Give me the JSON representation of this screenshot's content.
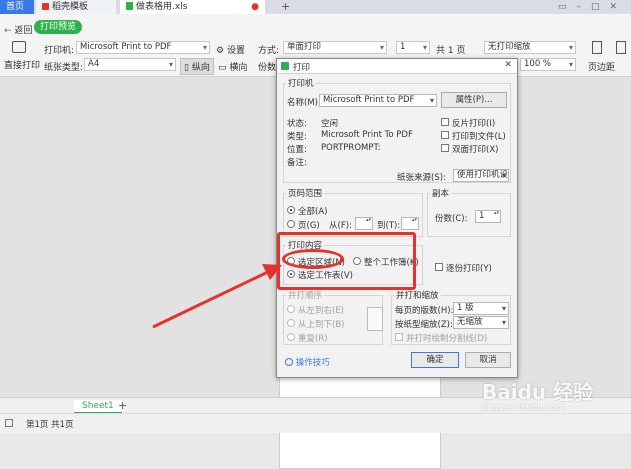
{
  "tabs": {
    "home": "首页",
    "daoke": "稻壳模板",
    "file": "做表格用.xls"
  },
  "toolbar": {
    "back": "返回",
    "preview": "打印预览",
    "printer_label": "打印机:",
    "printer_value": "Microsoft Print to PDF",
    "settings": "设置",
    "mode_label": "方式:",
    "mode_value": "单面打印",
    "copies_value": "1",
    "pages_total": "共 1 页",
    "scale_value": "无打印缩放",
    "direct_print": "直接打印",
    "paper_label": "纸张类型:",
    "paper_value": "A4",
    "portrait": "纵向",
    "landscape": "横向",
    "copies_label": "份数:",
    "zoom_value": "100 %",
    "margin": "页边距"
  },
  "dialog": {
    "title": "打印",
    "printer_group": "打印机",
    "name_label": "名称(M):",
    "name_value": "Microsoft Print to PDF",
    "properties_btn": "属性(P)...",
    "status_label": "状态:",
    "status_value": "空闲",
    "type_label": "类型:",
    "type_value": "Microsoft Print To PDF",
    "location_label": "位置:",
    "location_value": "PORTPROMPT:",
    "comment_label": "备注:",
    "reverse_print": "反片打印(I)",
    "print_to_file": "打印到文件(L)",
    "duplex": "双面打印(X)",
    "paper_source_label": "纸张来源(S):",
    "paper_source_value": "使用打印机设置",
    "range_group": "页码范围",
    "range_all": "全部(A)",
    "range_pages": "页(G)",
    "from_label": "从(F):",
    "to_label": "到(T):",
    "copies_group": "副本",
    "copies_label": "份数(C):",
    "copies_value": "1",
    "content_group": "打印内容",
    "sel_area": "选定区域(N)",
    "whole_book": "整个工作簿(K)",
    "sel_sheet": "选定工作表(V)",
    "collate": "逐份打印(Y)",
    "order_group": "并打顺序",
    "order_lr": "从左到右(E)",
    "order_tb": "从上到下(B)",
    "order_rep": "重复(R)",
    "scale_group": "并打和缩放",
    "per_page_label": "每页的版数(H):",
    "per_page_value": "1 版",
    "scale_label": "按纸型缩放(Z):",
    "scale_value": "无缩放",
    "draw_lines": "并打时绘制分割线(D)",
    "tips": "操作技巧",
    "ok": "确定",
    "cancel": "取消"
  },
  "sheetbar": {
    "sheet": "Sheet1",
    "add": "+"
  },
  "status": {
    "page_info": "第1页 共1页"
  },
  "watermark": {
    "logo": "Baidu 经验",
    "url": "jingyan.baidu.com"
  },
  "colors": {
    "accent": "#3b78e7",
    "preview_green": "#2bb24c",
    "annotation_red": "#e8312a"
  }
}
